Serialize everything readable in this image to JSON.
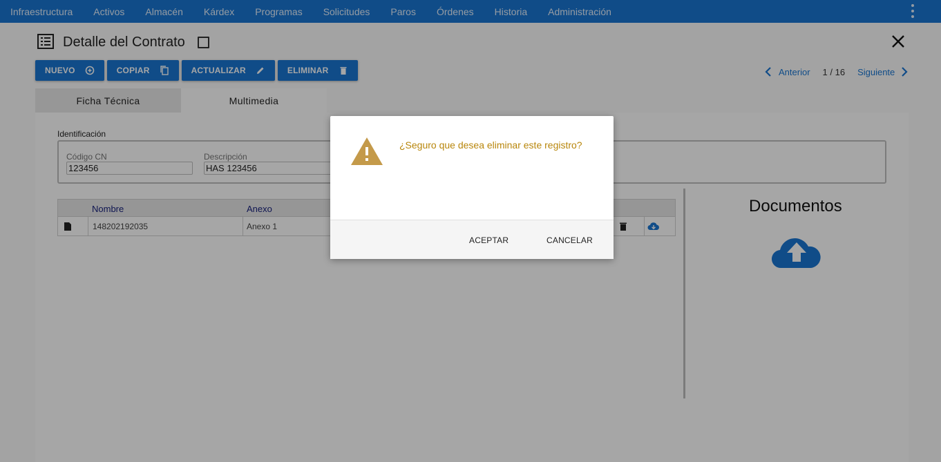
{
  "nav": {
    "items": [
      "Infraestructura",
      "Activos",
      "Almacén",
      "Kárdex",
      "Programas",
      "Solicitudes",
      "Paros",
      "Órdenes",
      "Historia",
      "Administración"
    ],
    "more_icon": "more-vert-icon"
  },
  "header": {
    "title": "Detalle del Contrato",
    "title_icon": "list-detail-icon",
    "close_icon": "close-icon"
  },
  "toolbar": {
    "nuevo": "NUEVO",
    "copiar": "COPIAR",
    "actualizar": "ACTUALIZAR",
    "eliminar": "ELIMINAR"
  },
  "pager": {
    "prev": "Anterior",
    "count": "1 / 16",
    "next": "Siguiente"
  },
  "tabs": [
    "Ficha Técnica",
    "Multimedia"
  ],
  "identificacion": {
    "section_label": "Identificación",
    "codigo_label": "Código CN",
    "codigo_value": "123456",
    "descripcion_label": "Descripción",
    "descripcion_value": "HAS 123456"
  },
  "table": {
    "headers": [
      "Nombre",
      "Anexo"
    ],
    "rows": [
      {
        "nombre": "148202192035",
        "anexo": "Anexo 1"
      }
    ]
  },
  "documentos": {
    "title": "Documentos",
    "icon": "cloud-upload-icon"
  },
  "dialog": {
    "message": "¿Seguro que desea eliminar este registro?",
    "accept": "ACEPTAR",
    "cancel": "CANCELAR",
    "icon": "warning-icon"
  },
  "colors": {
    "primary": "#1976d2",
    "warning": "#c49a4a"
  }
}
